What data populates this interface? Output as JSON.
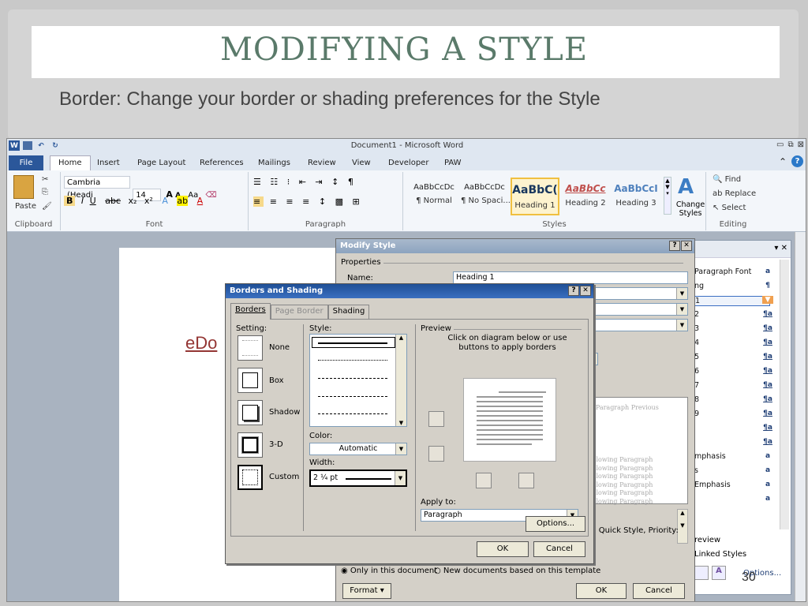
{
  "slide": {
    "title": "MODIFYING A STYLE",
    "subtitle": "Border: Change your border or shading preferences for the Style",
    "page_number": "30"
  },
  "word": {
    "window_title": "Document1 - Microsoft Word",
    "tabs": [
      "File",
      "Home",
      "Insert",
      "Page Layout",
      "References",
      "Mailings",
      "Review",
      "View",
      "Developer",
      "PAW"
    ],
    "ribbon": {
      "clipboard_label": "Clipboard",
      "paste_label": "Paste",
      "font_label": "Font",
      "font_name": "Cambria (Headi",
      "font_size": "14",
      "paragraph_label": "Paragraph",
      "styles_label": "Styles",
      "editing_label": "Editing",
      "styles": [
        {
          "preview": "AaBbCcDc",
          "name": "¶ Normal"
        },
        {
          "preview": "AaBbCcDc",
          "name": "¶ No Spaci..."
        },
        {
          "preview": "AaBbC(",
          "name": "Heading 1"
        },
        {
          "preview": "AaBbCc",
          "name": "Heading 2"
        },
        {
          "preview": "AaBbCcI",
          "name": "Heading 3"
        }
      ],
      "change_styles": "Change Styles",
      "find": "Find",
      "replace": "Replace",
      "select": "Select"
    },
    "doc_text": "eDo"
  },
  "styles_pane": {
    "rows": [
      {
        "label": "Paragraph Font",
        "icon": "a"
      },
      {
        "label": "ng",
        "icon": "¶"
      },
      {
        "label": "1",
        "icon": "▼"
      },
      {
        "label": "2",
        "icon": "¶a"
      },
      {
        "label": "3",
        "icon": "¶a"
      },
      {
        "label": "4",
        "icon": "¶a"
      },
      {
        "label": "5",
        "icon": "¶a"
      },
      {
        "label": "6",
        "icon": "¶a"
      },
      {
        "label": "7",
        "icon": "¶a"
      },
      {
        "label": "8",
        "icon": "¶a"
      },
      {
        "label": "9",
        "icon": "¶a"
      },
      {
        "label": "",
        "icon": "¶a"
      },
      {
        "label": "",
        "icon": "¶a"
      },
      {
        "label": "mphasis",
        "icon": "a"
      },
      {
        "label": "s",
        "icon": "a"
      },
      {
        "label": "Emphasis",
        "icon": "a"
      },
      {
        "label": "",
        "icon": "a"
      }
    ],
    "preview_label": "review",
    "linked_label": "Linked Styles",
    "options_label": "Options..."
  },
  "modify_style": {
    "title": "Modify Style",
    "properties_label": "Properties",
    "name_label": "Name:",
    "name_value": "Heading 1",
    "preview_lines": [
      "us Paragraph Previous",
      "ph"
    ],
    "following_lines": [
      "Following Paragraph",
      "Following Paragraph",
      "Following Paragraph",
      "Following Paragraph",
      "Following Paragraph",
      "Following Paragraph"
    ],
    "description_tail": "d, Quick Style, Priority:",
    "only_in_doc": "Only in this document",
    "new_docs": "New documents based on this template",
    "format_label": "Format",
    "ok": "OK",
    "cancel": "Cancel"
  },
  "borders_shading": {
    "title": "Borders and Shading",
    "tabs": {
      "borders": "Borders",
      "page_border": "Page Border",
      "shading": "Shading"
    },
    "setting_label": "Setting:",
    "settings": [
      "None",
      "Box",
      "Shadow",
      "3-D",
      "Custom"
    ],
    "style_label": "Style:",
    "color_label": "Color:",
    "color_value": "Automatic",
    "width_label": "Width:",
    "width_value": "2 ¼ pt",
    "preview_label": "Preview",
    "preview_hint": "Click on diagram below or use buttons to apply borders",
    "apply_to_label": "Apply to:",
    "apply_to_value": "Paragraph",
    "options_label": "Options...",
    "ok": "OK",
    "cancel": "Cancel"
  }
}
